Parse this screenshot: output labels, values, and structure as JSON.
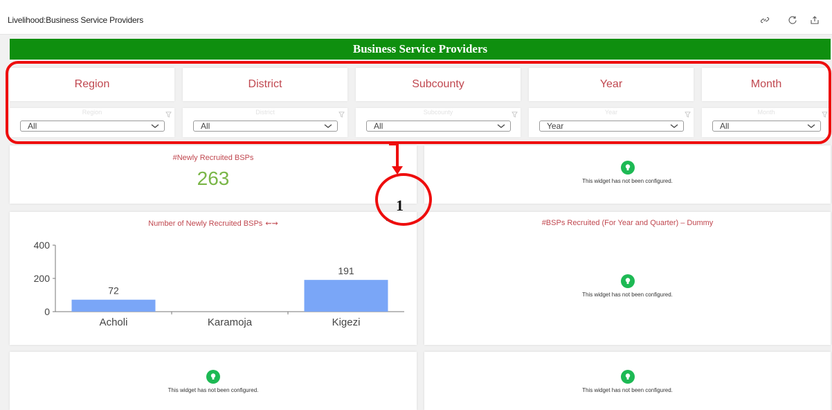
{
  "app": {
    "title": "Livelihood:Business Service Providers",
    "icons": [
      "link-icon",
      "refresh-icon",
      "export-icon"
    ]
  },
  "banner": {
    "title": "Business Service Providers",
    "color": "#0f8f0f"
  },
  "filters": [
    {
      "label": "Region",
      "placeholder": "Region",
      "value": "All"
    },
    {
      "label": "District",
      "placeholder": "District",
      "value": "All"
    },
    {
      "label": "Subcounty",
      "placeholder": "Subcounty",
      "value": "All"
    },
    {
      "label": "Year",
      "placeholder": "Year",
      "value": "Year"
    },
    {
      "label": "Month",
      "placeholder": "Month",
      "value": "All"
    }
  ],
  "kpi": {
    "title": "#Newly Recruited BSPs",
    "value": "263",
    "value_color": "#7ab648"
  },
  "chart_widget": {
    "title": "Number of Newly Recruited BSPs",
    "swap_glyph": "⇜⇝",
    "more": "..."
  },
  "chart_data": {
    "type": "bar",
    "categories": [
      "Acholi",
      "Karamoja",
      "Kigezi"
    ],
    "values": [
      72,
      0,
      191
    ],
    "data_labels": [
      "72",
      "",
      "191"
    ],
    "ylim": [
      0,
      400
    ],
    "yticks": [
      0,
      200,
      400
    ],
    "bar_color": "#7aa6f7",
    "grid": false,
    "legend": "none"
  },
  "dummy_widget": {
    "title": "#BSPs Recruited (For Year and Quarter) – Dummy"
  },
  "unconfigured_message": "This widget has not been configured.",
  "annotation": {
    "number": "1",
    "color": "#ee0d0d"
  },
  "accent_color": "#c0474f"
}
